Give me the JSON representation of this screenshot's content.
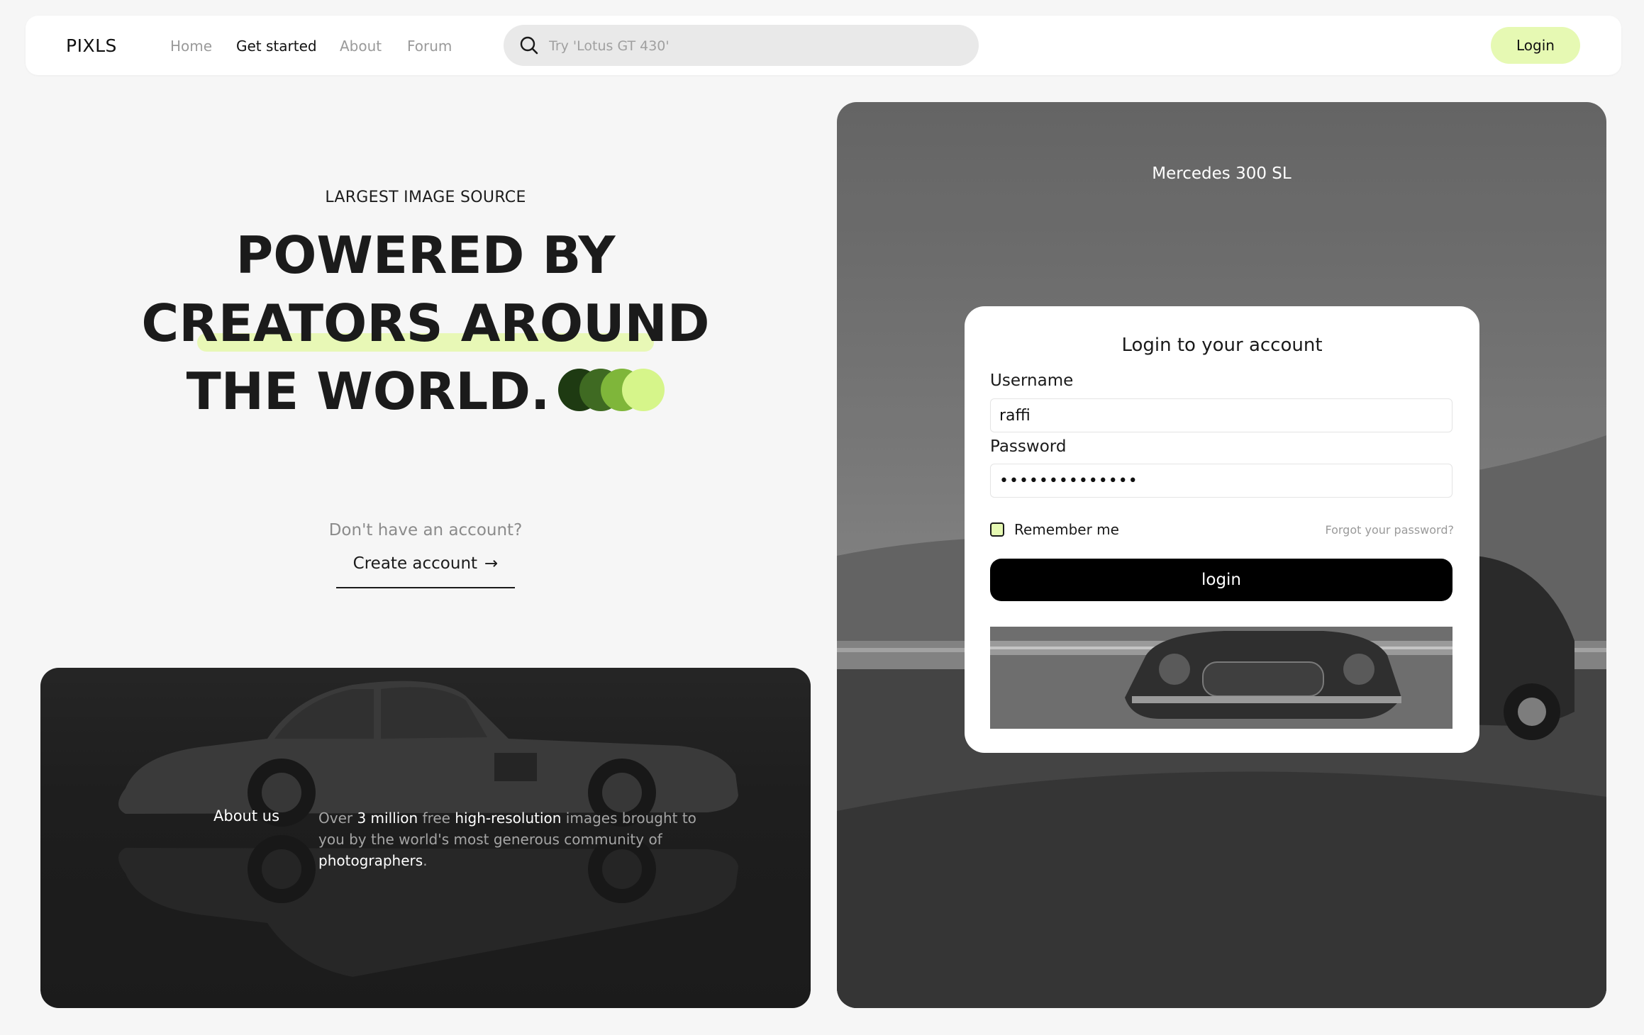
{
  "nav": {
    "logo": "PIXLS",
    "links": [
      {
        "label": "Home",
        "active": false
      },
      {
        "label": "Get started",
        "active": true
      },
      {
        "label": "About",
        "active": false
      },
      {
        "label": "Forum",
        "active": false
      }
    ],
    "search_placeholder": "Try 'Lotus GT 430'",
    "login_label": "Login"
  },
  "hero": {
    "eyebrow": "LARGEST IMAGE SOURCE",
    "line1": "POWERED BY",
    "line2": "CREATORS AROUND",
    "line3": "THE WORLD.",
    "dot_colors": [
      "#1e3a12",
      "#3f6a22",
      "#7fb63a",
      "#d6f58a"
    ],
    "no_account": "Don't have an account?",
    "create_account": "Create account",
    "create_arrow": "→"
  },
  "about": {
    "label": "About us",
    "parts": [
      {
        "text": "Over ",
        "strong": false
      },
      {
        "text": "3 million",
        "strong": true
      },
      {
        "text": " free ",
        "strong": false
      },
      {
        "text": "high-resolution",
        "strong": true
      },
      {
        "text": " images brought to you by the world's most generous community of ",
        "strong": false
      },
      {
        "text": "photographers",
        "strong": true
      },
      {
        "text": ".",
        "strong": false
      }
    ]
  },
  "panel": {
    "caption": "Mercedes 300 SL"
  },
  "login": {
    "title": "Login to your account",
    "username_label": "Username",
    "username_value": "raffi",
    "password_label": "Password",
    "password_value": "••••••••••••••",
    "remember_label": "Remember me",
    "forgot_label": "Forgot your password?",
    "submit_label": "login"
  },
  "colors": {
    "accent": "#e6f9b3",
    "highlight": "#e8f8b6",
    "button": "#000000"
  }
}
